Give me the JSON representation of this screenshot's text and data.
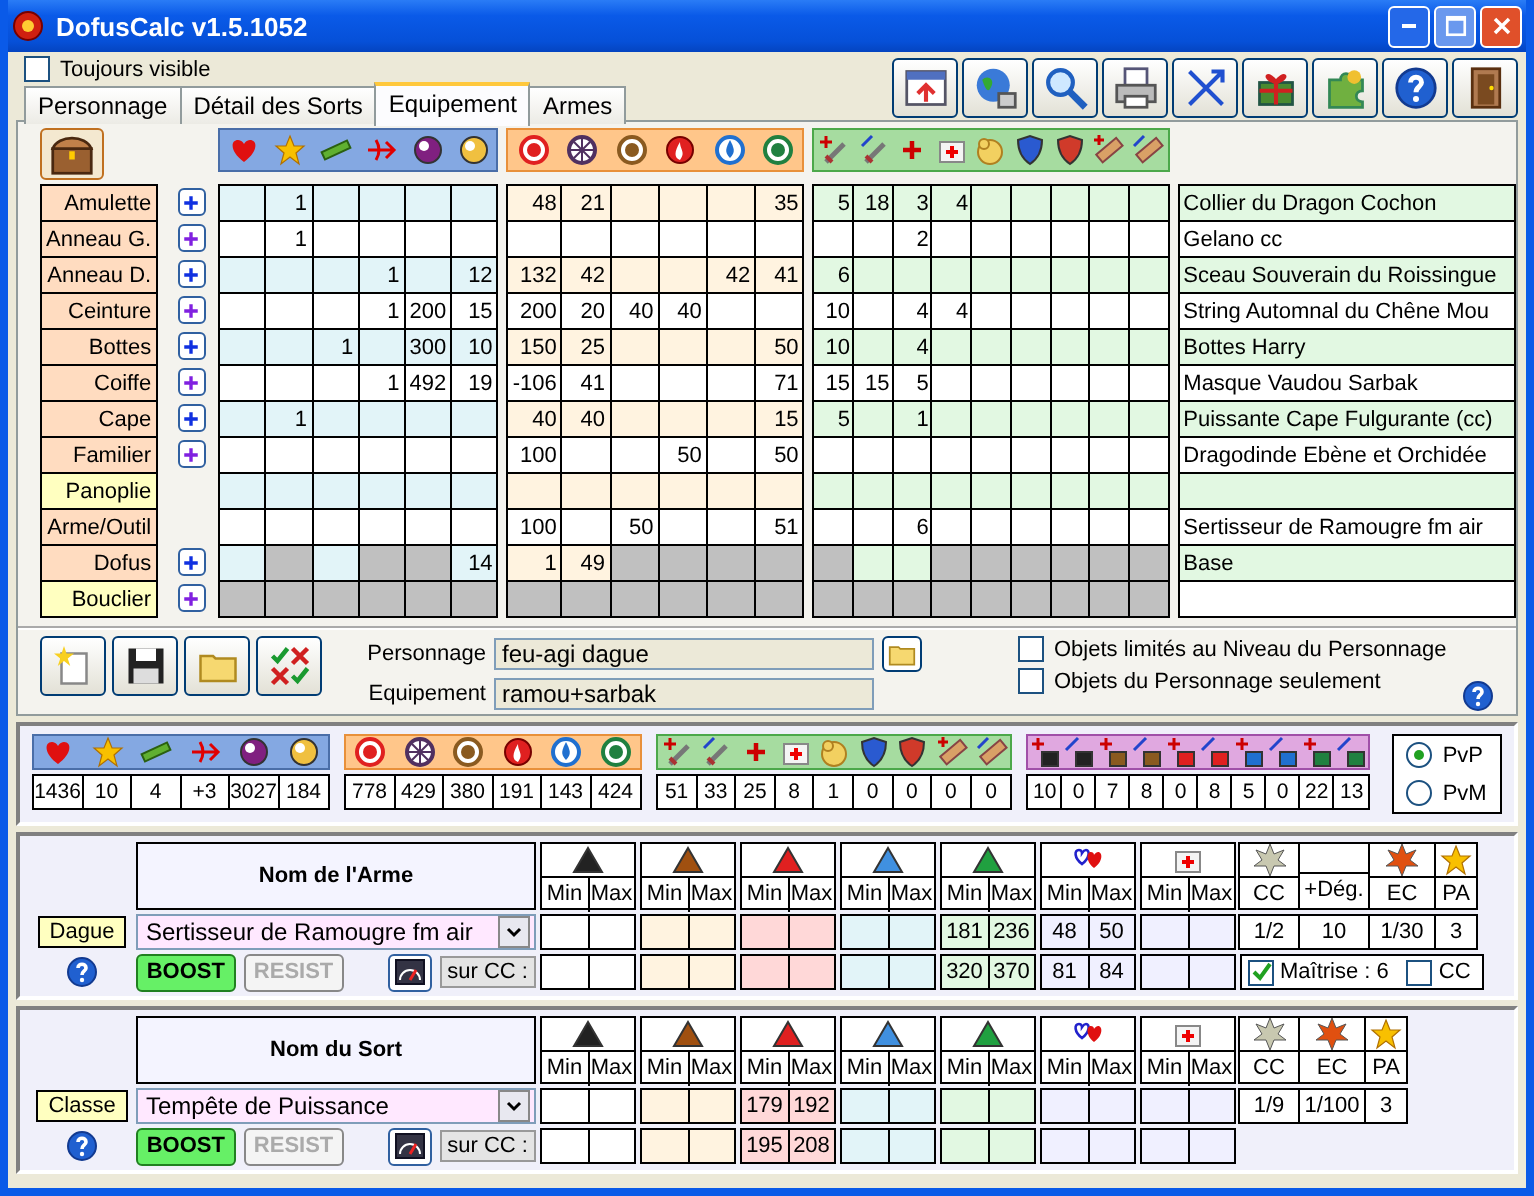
{
  "window": {
    "title": "DofusCalc v1.5.1052"
  },
  "always_visible": {
    "label": "Toujours visible",
    "checked": false
  },
  "tabs": [
    {
      "label": "Personnage",
      "selected": false
    },
    {
      "label": "Détail des Sorts",
      "selected": false
    },
    {
      "label": "Equipement",
      "selected": true
    },
    {
      "label": "Armes",
      "selected": false
    }
  ],
  "equipment": [
    {
      "slot": "Amulette",
      "color": "#ffdcc0",
      "add": true,
      "stats": {
        "column_2": "1"
      },
      "elements": {
        "column_1": "48",
        "column_2": "21",
        "column_6": "35"
      },
      "bonuses": {
        "column_1": "5",
        "column_2": "18",
        "column_3": "3",
        "column_4": "4"
      },
      "item": "Collier du Dragon Cochon"
    },
    {
      "slot": "Anneau G.",
      "color": "#ffdcc0",
      "add": true,
      "stats": {
        "column_2": "1"
      },
      "bonuses": {
        "column_3": "2"
      },
      "item": "Gelano cc"
    },
    {
      "slot": "Anneau D.",
      "color": "#ffdcc0",
      "add": true,
      "stats": {
        "column_4": "1",
        "column_6": "12"
      },
      "elements": {
        "column_1": "132",
        "column_2": "42",
        "column_5": "42",
        "column_6": "41"
      },
      "bonuses": {
        "column_1": "6"
      },
      "item": "Sceau Souverain du Roissingue"
    },
    {
      "slot": "Ceinture",
      "color": "#ffdcc0",
      "add": true,
      "stats": {
        "column_4": "1",
        "column_5": "200",
        "column_6": "15"
      },
      "elements": {
        "column_1": "200",
        "column_2": "20",
        "column_3": "40",
        "column_4": "40"
      },
      "bonuses": {
        "column_1": "10",
        "column_3": "4",
        "column_4": "4"
      },
      "item": "String Automnal du Chêne Mou"
    },
    {
      "slot": "Bottes",
      "color": "#ffdcc0",
      "add": true,
      "stats": {
        "column_3": "1",
        "column_5": "300",
        "column_6": "10"
      },
      "elements": {
        "column_1": "150",
        "column_2": "25",
        "column_6": "50"
      },
      "bonuses": {
        "column_1": "10",
        "column_3": "4"
      },
      "item": "Bottes Harry"
    },
    {
      "slot": "Coiffe",
      "color": "#ffdcc0",
      "add": true,
      "stats": {
        "column_4": "1",
        "column_5": "492",
        "column_6": "19"
      },
      "elements": {
        "column_1": "-106",
        "column_2": "41",
        "column_6": "71"
      },
      "bonuses": {
        "column_1": "15",
        "column_2": "15",
        "column_3": "5"
      },
      "item": "Masque Vaudou Sarbak"
    },
    {
      "slot": "Cape",
      "color": "#ffdcc0",
      "add": true,
      "stats": {
        "column_2": "1"
      },
      "elements": {
        "column_1": "40",
        "column_2": "40",
        "column_6": "15"
      },
      "bonuses": {
        "column_1": "5",
        "column_3": "1"
      },
      "item": "Puissante Cape Fulgurante (cc)"
    },
    {
      "slot": "Familier",
      "color": "#ffdcc0",
      "add": true,
      "elements": {
        "column_1": "100",
        "column_4": "50",
        "column_6": "50"
      },
      "item": "Dragodinde Ebène et Orchidée"
    },
    {
      "slot": "Panoplie",
      "color": "#ffffc0"
    },
    {
      "slot": "Arme/Outil",
      "color": "#ffdcc0",
      "elements": {
        "column_1": "100",
        "column_3": "50",
        "column_6": "51"
      },
      "bonuses": {
        "column_3": "6"
      },
      "item": "Sertisseur de Ramougre fm air"
    },
    {
      "slot": "Dofus",
      "color": "#ffdcc0",
      "add": true,
      "stats": {
        "column_6": "14"
      },
      "elements": {
        "column_1": "1",
        "column_2": "49"
      },
      "item": "Base",
      "disabled": {
        "stats": {
          "column_2": true,
          "column_4": true,
          "column_5": true
        },
        "elements": {
          "column_3": true,
          "column_4": true,
          "column_5": true,
          "column_6": true
        },
        "bonuses": {
          "column_1": true,
          "column_4": true,
          "column_5": true,
          "column_6": true,
          "column_7": true,
          "column_8": true,
          "column_9": true
        }
      }
    },
    {
      "slot": "Bouclier",
      "color": "#ffffc0",
      "add": true,
      "disabled": {
        "stats": {
          "column_1": true,
          "column_2": true,
          "column_3": true,
          "column_4": true,
          "column_5": true,
          "column_6": true
        },
        "elements": {
          "column_1": true,
          "column_2": true,
          "column_3": true,
          "column_4": true,
          "column_5": true,
          "column_6": true
        },
        "bonuses": {
          "column_1": true,
          "column_2": true,
          "column_3": true,
          "column_4": true,
          "column_5": true,
          "column_6": true,
          "column_7": true,
          "column_8": true,
          "column_9": true
        }
      }
    }
  ],
  "profile": {
    "character_label": "Personnage",
    "character": "feu-agi dague",
    "equipment_label": "Equipement",
    "equipment": "ramou+sarbak"
  },
  "filters": [
    {
      "label": "Objets limités au Niveau du Personnage",
      "checked": false
    },
    {
      "label": "Objets du Personnage seulement",
      "checked": false
    }
  ],
  "totals": {
    "stats": [
      "1436",
      "10",
      "4",
      "+3",
      "3027",
      "184"
    ],
    "elements": [
      "778",
      "429",
      "380",
      "191",
      "143",
      "424"
    ],
    "bonuses": [
      "51",
      "33",
      "25",
      "8",
      "1",
      "0",
      "0",
      "0",
      "0"
    ],
    "resistances": [
      "10",
      "0",
      "7",
      "8",
      "0",
      "8",
      "5",
      "0",
      "22",
      "13"
    ]
  },
  "mode": [
    {
      "label": "PvP",
      "selected": true
    },
    {
      "label": "PvM",
      "selected": false
    }
  ],
  "panels": [
    {
      "slot": "Dague",
      "name_header": "Nom de l'Arme",
      "selection": "Sertisseur de Ramougre fm air",
      "crit_label": "sur CC :",
      "toggles": [
        {
          "label": "BOOST",
          "on": true,
          "disabled": false
        },
        {
          "label": "RESIST",
          "on": false,
          "disabled": true
        }
      ],
      "damage": [
        {
          "min_label": "Min",
          "max_label": "Max"
        },
        {
          "min_label": "Min",
          "max_label": "Max"
        },
        {
          "min_label": "Min",
          "max_label": "Max"
        },
        {
          "min_label": "Min",
          "max_label": "Max"
        },
        {
          "min_label": "Min",
          "max_label": "Max",
          "hit": {
            "min": "181",
            "max": "236"
          },
          "crit": {
            "min": "320",
            "max": "370"
          }
        },
        {
          "min_label": "Min",
          "max_label": "Max",
          "hit": {
            "min": "48",
            "max": "50"
          },
          "crit": {
            "min": "81",
            "max": "84"
          }
        },
        {
          "min_label": "Min",
          "max_label": "Max"
        }
      ],
      "extras": [
        {
          "kind": "cc",
          "label": "CC",
          "value": "1/2"
        },
        {
          "kind": "damage",
          "label": "+Dég.",
          "value": "10"
        },
        {
          "kind": "ec",
          "label": "EC",
          "value": "1/30"
        },
        {
          "kind": "pa",
          "label": "PA",
          "value": "3"
        }
      ],
      "mastery": {
        "label": "Maîtrise : 6",
        "checked": true
      },
      "crit_toggle": {
        "label": "CC",
        "checked": false
      }
    },
    {
      "slot": "Classe",
      "name_header": "Nom du Sort",
      "selection": "Tempête de Puissance",
      "crit_label": "sur CC :",
      "toggles": [
        {
          "label": "BOOST",
          "on": true,
          "disabled": false
        },
        {
          "label": "RESIST",
          "on": false,
          "disabled": true
        }
      ],
      "damage": [
        {
          "min_label": "Min",
          "max_label": "Max"
        },
        {
          "min_label": "Min",
          "max_label": "Max"
        },
        {
          "min_label": "Min",
          "max_label": "Max",
          "hit": {
            "min": "179",
            "max": "192"
          },
          "crit": {
            "min": "195",
            "max": "208"
          }
        },
        {
          "min_label": "Min",
          "max_label": "Max"
        },
        {
          "min_label": "Min",
          "max_label": "Max"
        },
        {
          "min_label": "Min",
          "max_label": "Max"
        },
        {
          "min_label": "Min",
          "max_label": "Max"
        }
      ],
      "extras": [
        {
          "kind": "cc",
          "label": "CC",
          "value": "1/9"
        },
        {
          "kind": "ec",
          "label": "EC",
          "value": "1/100"
        },
        {
          "kind": "pa",
          "label": "PA",
          "value": "3"
        }
      ]
    }
  ]
}
